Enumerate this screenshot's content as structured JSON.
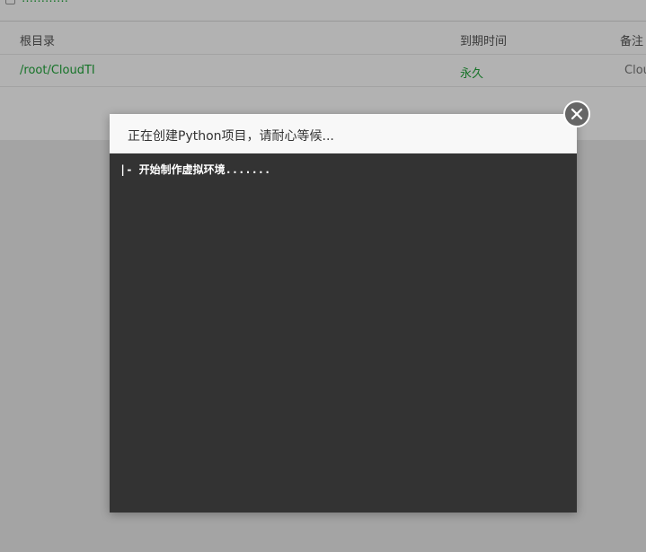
{
  "background": {
    "top_link": "…………",
    "table": {
      "headers": [
        "根目录",
        "到期时间",
        "备注"
      ],
      "row": {
        "root": "/root/CloudTI",
        "expire": "永久",
        "note": "Clou"
      }
    }
  },
  "modal": {
    "title": "正在创建Python项目，请耐心等候...",
    "terminal_line": "|- 开始制作虚拟环境.......",
    "close_icon": "close-icon"
  },
  "colors": {
    "accent": "#20a53a",
    "terminal_bg": "#333333",
    "overlay": "rgba(0,0,0,0.3)"
  }
}
